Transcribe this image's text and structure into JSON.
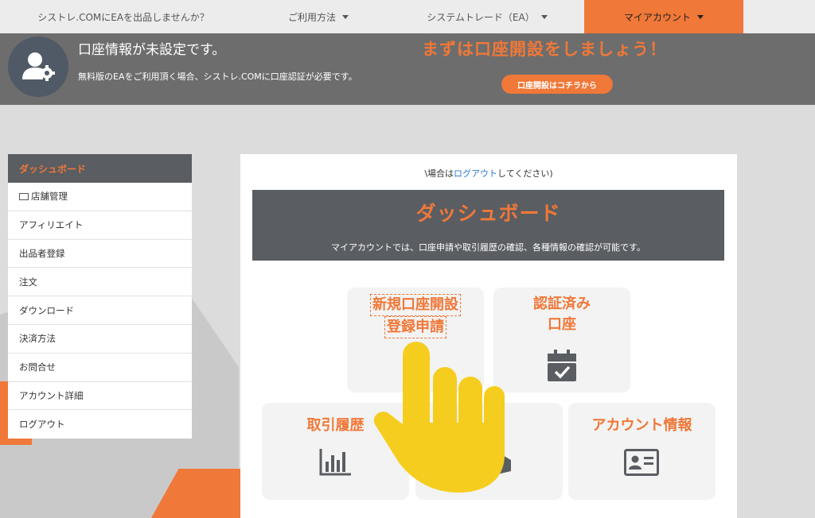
{
  "nav": {
    "item1": "シストレ.COMにEAを出品しませんか？",
    "item2": "ご利用方法",
    "item3": "システムトレード（EA）",
    "item4": "マイアカウント"
  },
  "banner": {
    "title": "口座情報が未設定です。",
    "desc": "無料版のEAをご利用頂く場合、シストレ.COMに口座認証が必要です。",
    "cta": "まずは口座開設をしましょう！",
    "button": "口座開設はコチラから"
  },
  "sidebar": {
    "header": "ダッシュボード",
    "items": [
      {
        "label": "店舗管理"
      },
      {
        "label": "アフィリエイト"
      },
      {
        "label": "出品者登録"
      },
      {
        "label": "注文"
      },
      {
        "label": "ダウンロード"
      },
      {
        "label": "決済方法"
      },
      {
        "label": "お問合せ"
      },
      {
        "label": "アカウント詳細"
      },
      {
        "label": "ログアウト"
      }
    ]
  },
  "main": {
    "note_prefix": "\\場合は",
    "note_link": "ログアウト",
    "note_suffix": "してください)",
    "title": "ダッシュボード",
    "subtitle": "マイアカウントでは、口座申請や取引履歴の確認、各種情報の確認が可能です。",
    "cards": {
      "new_account_line1": "新規口座開設",
      "new_account_line2": "登録申請",
      "verified_line1": "認証済み",
      "verified_line2": "口座",
      "history": "取引履歴",
      "account_info": "アカウント情報"
    }
  },
  "colors": {
    "accent": "#f07838",
    "dark_panel": "#5a5d62",
    "link": "#2a7bd4",
    "hand": "#f5cd1e"
  }
}
